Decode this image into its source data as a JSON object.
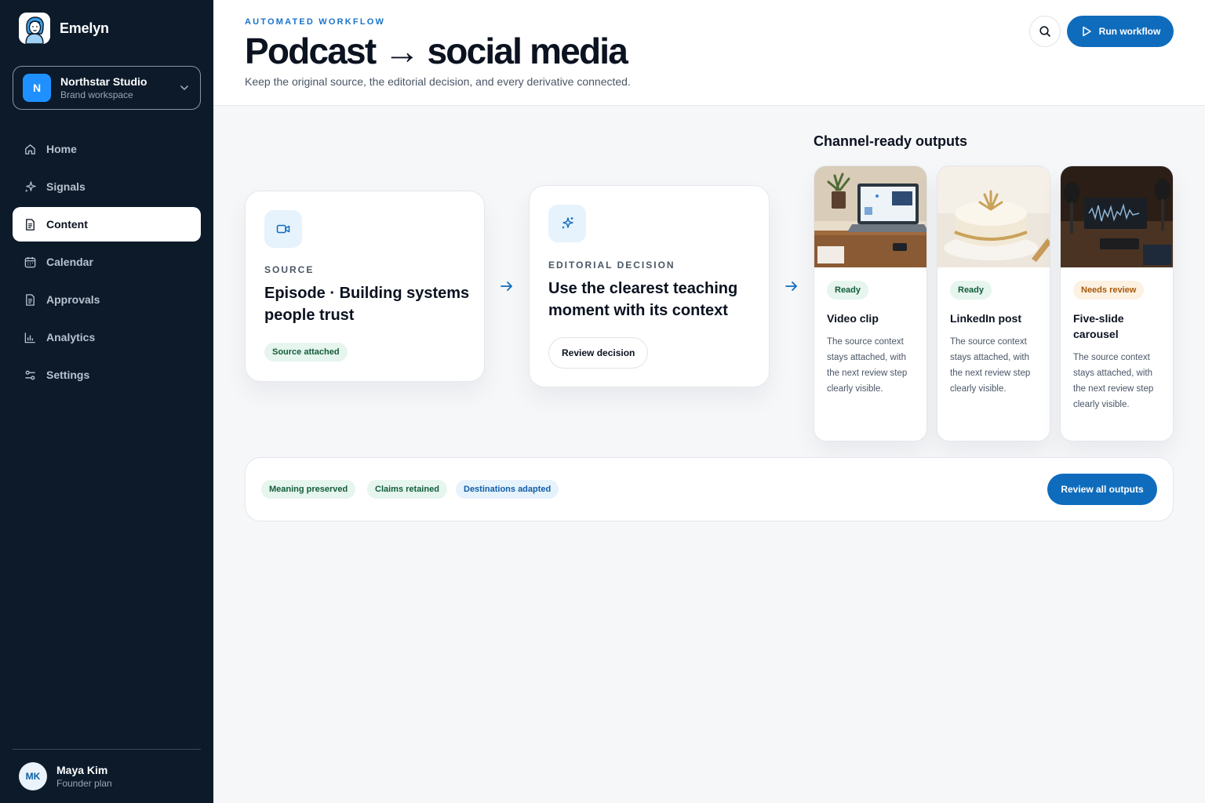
{
  "app": {
    "name": "Emelyn"
  },
  "workspace": {
    "name": "Northstar Studio",
    "subtitle": "Brand workspace",
    "initial": "N"
  },
  "nav": {
    "items": [
      {
        "label": "Home",
        "icon": "home-icon"
      },
      {
        "label": "Signals",
        "icon": "sparkle-icon"
      },
      {
        "label": "Content",
        "icon": "document-icon",
        "active": true
      },
      {
        "label": "Calendar",
        "icon": "calendar-icon"
      },
      {
        "label": "Approvals",
        "icon": "document-check-icon"
      },
      {
        "label": "Analytics",
        "icon": "bar-chart-icon"
      },
      {
        "label": "Settings",
        "icon": "sliders-icon"
      }
    ]
  },
  "user": {
    "initials": "MK",
    "name": "Maya Kim",
    "plan": "Founder plan"
  },
  "header": {
    "eyebrow": "AUTOMATED WORKFLOW",
    "title": "Podcast → social media",
    "subtitle": "Keep the original source, the editorial decision, and every derivative connected.",
    "run_label": "Run workflow"
  },
  "source": {
    "label": "SOURCE",
    "title": "Episode · Building systems people trust",
    "badge": "Source attached"
  },
  "decision": {
    "label": "EDITORIAL DECISION",
    "title": "Use the clearest teaching moment with its context",
    "button": "Review decision"
  },
  "outputs": {
    "title": "Channel-ready outputs",
    "items": [
      {
        "status": "Ready",
        "status_type": "ready",
        "title": "Video clip",
        "description": "The source context stays attached, with the next review step clearly visible."
      },
      {
        "status": "Ready",
        "status_type": "ready",
        "title": "LinkedIn post",
        "description": "The source context stays attached, with the next review step clearly visible."
      },
      {
        "status": "Needs review",
        "status_type": "review",
        "title": "Five-slide carousel",
        "description": "The source context stays attached, with the next review step clearly visible."
      }
    ]
  },
  "checks": {
    "items": [
      "Meaning preserved",
      "Claims retained",
      "Destinations adapted"
    ],
    "button": "Review all outputs"
  },
  "colors": {
    "accent": "#0f6cbd",
    "sidebar": "#0c1a2a",
    "ready": "#e6f5ee",
    "review": "#fdf1e2"
  }
}
